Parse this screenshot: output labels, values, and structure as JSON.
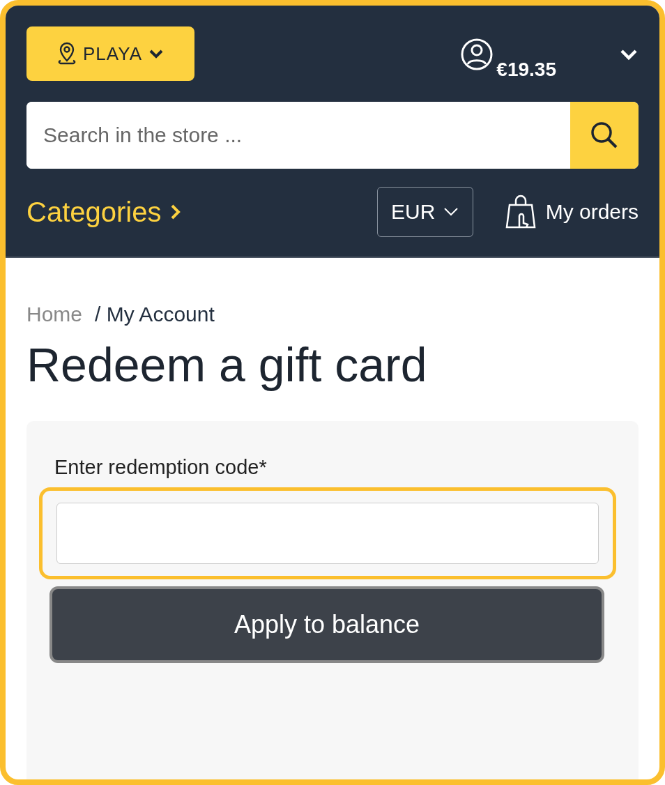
{
  "header": {
    "location_button": {
      "label": "PLAYA"
    },
    "balance": "€19.35",
    "search": {
      "placeholder": "Search in the store ..."
    },
    "categories": "Categories",
    "currency": {
      "value": "EUR"
    },
    "orders": "My orders"
  },
  "breadcrumb": [
    {
      "label": "Home",
      "current": false
    },
    {
      "label": "/ My Account",
      "current": true
    }
  ],
  "title": "Redeem a gift card",
  "form": {
    "label": "Enter redemption code*",
    "focused": true,
    "button": "Apply to balance"
  }
}
